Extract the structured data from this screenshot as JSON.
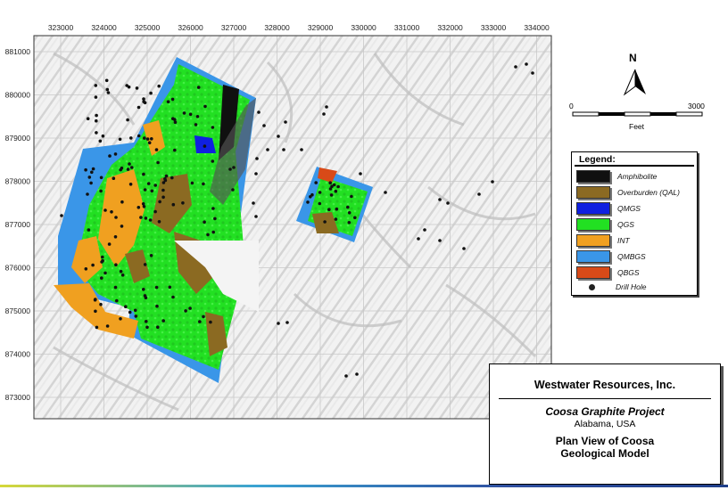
{
  "map": {
    "x_ticks": [
      "323000",
      "324000",
      "325000",
      "326000",
      "327000",
      "328000",
      "329000",
      "330000",
      "331000",
      "332000",
      "333000",
      "334000"
    ],
    "y_ticks": [
      "881000",
      "880000",
      "879000",
      "878000",
      "877000",
      "876000",
      "875000",
      "874000",
      "873000"
    ]
  },
  "north_arrow": {
    "label": "N",
    "icon": "north-arrow-icon"
  },
  "scale_bar": {
    "start_label": "0",
    "end_label": "3000",
    "unit": "Feet"
  },
  "legend": {
    "title": "Legend:",
    "items": [
      {
        "label": "Amphibolite",
        "color": "#101010"
      },
      {
        "label": "Overburden (QAL)",
        "color": "#8b6a22"
      },
      {
        "label": "QMGS",
        "color": "#1020e0"
      },
      {
        "label": "QGS",
        "color": "#22e022"
      },
      {
        "label": "INT",
        "color": "#f0a020"
      },
      {
        "label": "QMBGS",
        "color": "#3a96e8"
      },
      {
        "label": "QBGS",
        "color": "#d84a18"
      }
    ],
    "drill_hole_label": "Drill Hole"
  },
  "title_block": {
    "company": "Westwater Resources, Inc.",
    "project": "Coosa Graphite Project",
    "location": "Alabama, USA",
    "plan_line1": "Plan View of Coosa",
    "plan_line2": "Geological Model"
  }
}
